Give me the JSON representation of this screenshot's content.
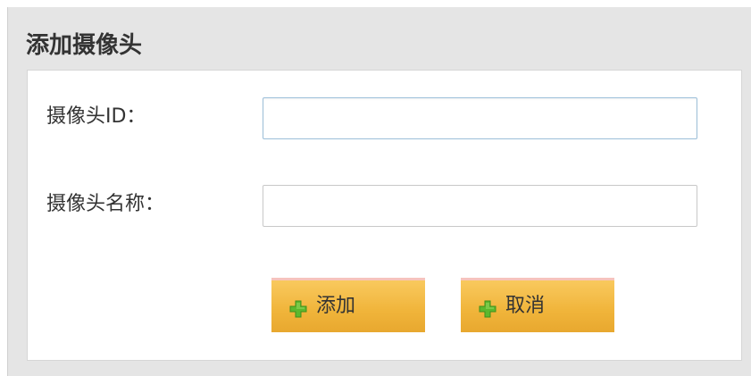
{
  "dialog": {
    "title": "添加摄像头"
  },
  "form": {
    "camera_id": {
      "label": "摄像头ID：",
      "value": "",
      "placeholder": ""
    },
    "camera_name": {
      "label": "摄像头名称：",
      "value": "",
      "placeholder": ""
    }
  },
  "buttons": {
    "add": {
      "label": "添加",
      "icon": "plus-icon"
    },
    "cancel": {
      "label": "取消",
      "icon": "plus-icon"
    }
  },
  "colors": {
    "button_gradient_top": "#f9c95e",
    "button_gradient_bottom": "#e8a82f",
    "button_top_border": "#f6c3bd",
    "icon_green": "#5cb82e",
    "focused_border": "#9cbfd9"
  }
}
